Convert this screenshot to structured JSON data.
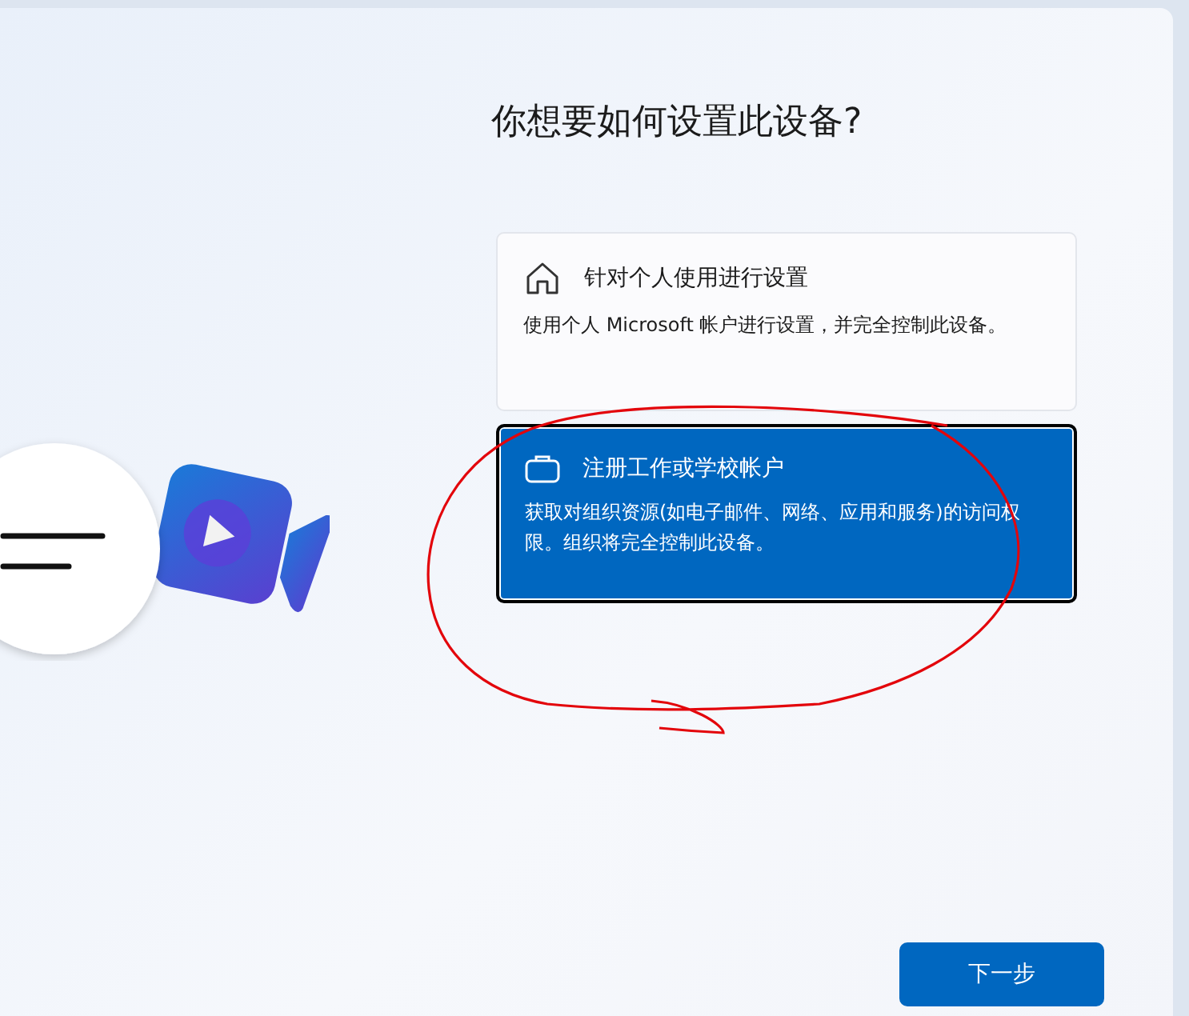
{
  "title": "你想要如何设置此设备?",
  "options": [
    {
      "kind": "home",
      "heading": "针对个人使用进行设置",
      "description": "使用个人 Microsoft 帐户进行设置，并完全控制此设备。",
      "selected": false
    },
    {
      "kind": "work",
      "heading": "注册工作或学校帐户",
      "description": "获取对组织资源(如电子邮件、网络、应用和服务)的访问权限。组织将完全控制此设备。",
      "selected": true
    }
  ],
  "next_button": "下一步"
}
